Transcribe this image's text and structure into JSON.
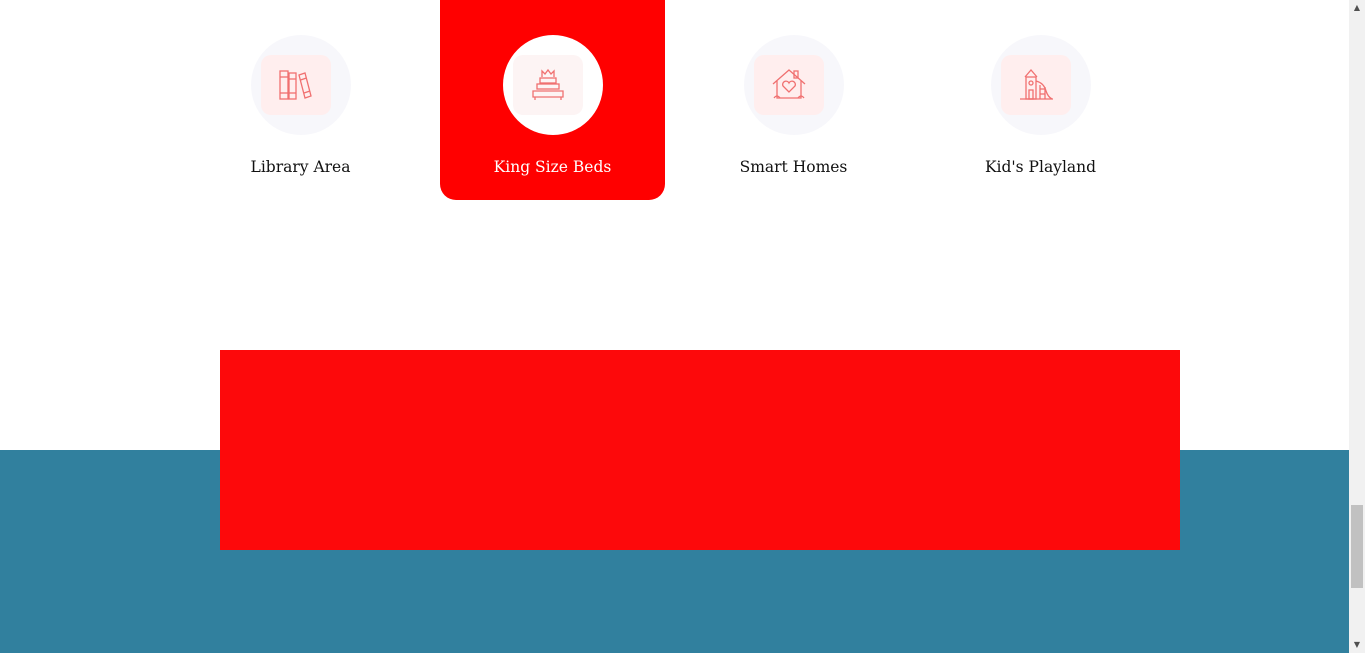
{
  "amenities": [
    {
      "label": "Library Area",
      "icon": "books-icon",
      "active": false
    },
    {
      "label": "King Size Beds",
      "icon": "bed-icon",
      "active": true
    },
    {
      "label": "Smart Homes",
      "icon": "smart-home-icon",
      "active": false
    },
    {
      "label": "Kid's Playland",
      "icon": "playland-icon",
      "active": false
    }
  ],
  "colors": {
    "active_bg": "#ff0000",
    "banner": "#fd090b",
    "band": "#31809e",
    "icon_stroke": "#f26d6d"
  },
  "scrollbar": {
    "up_glyph": "▲",
    "down_glyph": "▼"
  }
}
